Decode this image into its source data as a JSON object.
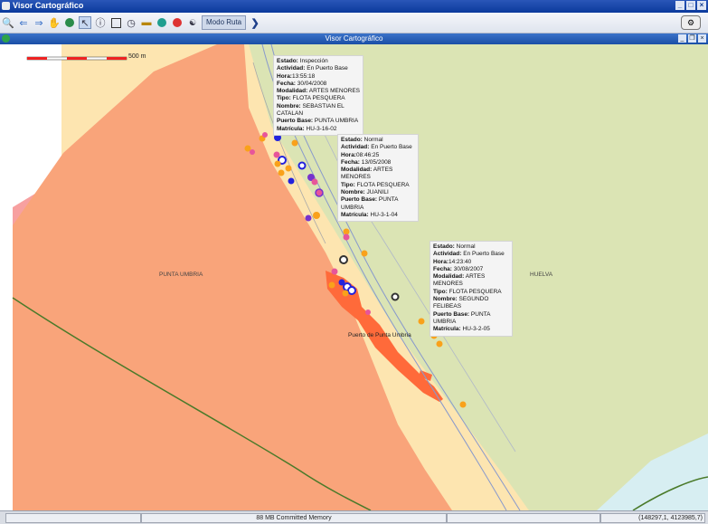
{
  "window": {
    "title": "Visor Cartográfico"
  },
  "toolbar": {
    "route_label": "Modo Ruta"
  },
  "map_frame": {
    "title": "Visor Cartográfico"
  },
  "map": {
    "scale_label": "500 m",
    "places": {
      "punta_umbria": "PUNTA UMBRIA",
      "huelva": "HUELVA",
      "port": "Puerto de Punta Umbria"
    },
    "popups": [
      {
        "estado_k": "Estado:",
        "estado": "Inspección",
        "actividad_k": "Actividad:",
        "actividad": "En Puerto Base",
        "hora_k": "Hora:",
        "hora": "13:55:18",
        "fecha_k": "Fecha:",
        "fecha": "30/04/2008",
        "modalidad_k": "Modalidad:",
        "modalidad": "ARTES MENORES",
        "tipo_k": "Tipo:",
        "tipo": "FLOTA PESQUERA",
        "nombre_k": "Nombre:",
        "nombre": "SEBASTIAN EL CATALAN",
        "puerto_k": "Puerto Base:",
        "puerto": "PUNTA UMBRIA",
        "matricula_k": "Matrícula:",
        "matricula": "HU-3-16-02"
      },
      {
        "estado_k": "Estado:",
        "estado": "Normal",
        "actividad_k": "Actividad:",
        "actividad": "En Puerto Base",
        "hora_k": "Hora:",
        "hora": "08:46:25",
        "fecha_k": "Fecha:",
        "fecha": "13/05/2008",
        "modalidad_k": "Modalidad:",
        "modalidad": "ARTES MENORES",
        "tipo_k": "Tipo:",
        "tipo": "FLOTA PESQUERA",
        "nombre_k": "Nombre:",
        "nombre": "JUANILI",
        "puerto_k": "Puerto Base:",
        "puerto": "PUNTA UMBRIA",
        "matricula_k": "Matrícula:",
        "matricula": "HU-3-1-04"
      },
      {
        "estado_k": "Estado:",
        "estado": "Normal",
        "actividad_k": "Actividad:",
        "actividad": "En Puerto Base",
        "hora_k": "Hora:",
        "hora": "14:23:40",
        "fecha_k": "Fecha:",
        "fecha": "30/08/2007",
        "modalidad_k": "Modalidad:",
        "modalidad": "ARTES MENORES",
        "tipo_k": "Tipo:",
        "tipo": "FLOTA PESQUERA",
        "nombre_k": "Nombre:",
        "nombre": "SEGUNDO FELIBEAS",
        "puerto_k": "Puerto Base:",
        "puerto": "PUNTA UMBRIA",
        "matricula_k": "Matrícula:",
        "matricula": "HU-3-2-05"
      }
    ]
  },
  "status": {
    "memory": "88 MB Committed Memory",
    "coords": "(148297,1, 4123985,7)"
  },
  "colors": {
    "land_green": "#dbe4b4",
    "land_sand": "#fde5b0",
    "land_orange": "#f9a47a",
    "port_red": "#ff6a3a",
    "vessel_orange": "#f9a11b",
    "vessel_blue": "#2222dd"
  }
}
